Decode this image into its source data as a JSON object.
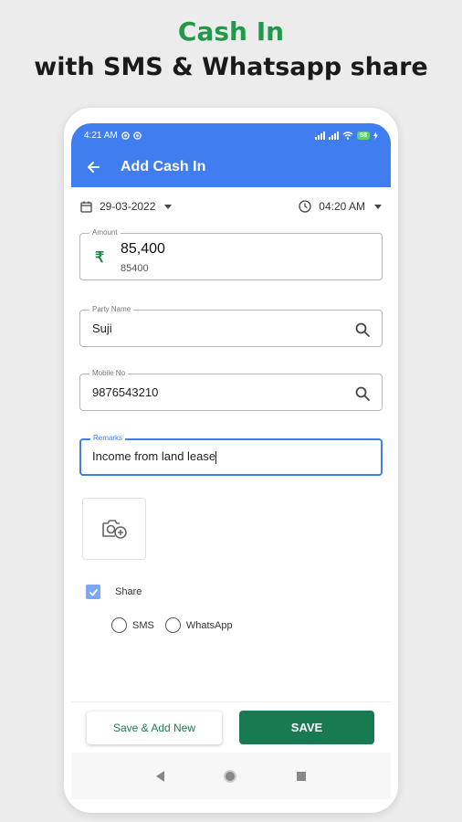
{
  "promo": {
    "title": "Cash In",
    "subtitle": "with SMS & Whatsapp share"
  },
  "status_bar": {
    "time": "4:21 AM",
    "battery": "58"
  },
  "app_bar": {
    "back_icon": "arrow-left-icon",
    "title": "Add Cash In"
  },
  "date": "29-03-2022",
  "time": "04:20 AM",
  "form": {
    "amount": {
      "label": "Amount",
      "currency_symbol": "₹",
      "value": "85,400",
      "raw": "85400"
    },
    "party_name": {
      "label": "Party Name",
      "value": "Suji"
    },
    "mobile": {
      "label": "Mobile No",
      "value": "9876543210"
    },
    "remarks": {
      "label": "Remarks",
      "value": "Income from land lease"
    }
  },
  "share": {
    "label": "Share",
    "checked": true,
    "options": [
      "SMS",
      "WhatsApp"
    ]
  },
  "buttons": {
    "save_add_new": "Save & Add New",
    "save": "SAVE"
  },
  "colors": {
    "primary": "#3f7df1",
    "title_green": "#1f9a4a",
    "save_green": "#177a50"
  }
}
